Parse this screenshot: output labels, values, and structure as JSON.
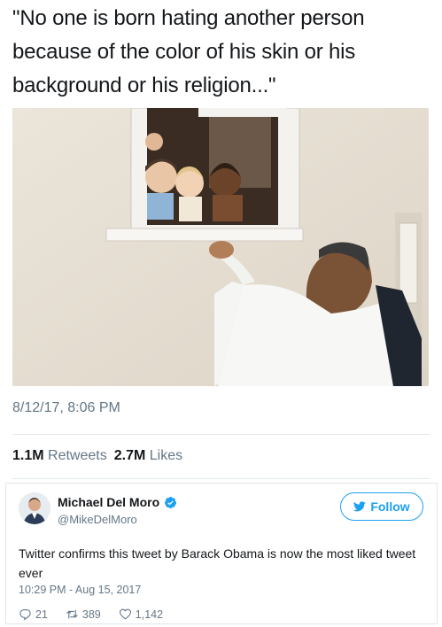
{
  "main_tweet": {
    "quote_lines": [
      "\"No one is born hating another person",
      "because of the color of his skin or his",
      "background or his religion...\""
    ],
    "timestamp": "8/12/17, 8:06 PM",
    "retweets_count": "1.1M",
    "retweets_label": "Retweets",
    "likes_count": "2.7M",
    "likes_label": "Likes"
  },
  "embedded_tweet": {
    "author_name": "Michael Del Moro",
    "author_handle": "@MikeDelMoro",
    "verified": true,
    "follow_label": "Follow",
    "text": "Twitter confirms this tweet by Barack Obama is now the most liked tweet ever",
    "time": "10:29 PM - Aug 15, 2017",
    "replies": "21",
    "retweets": "389",
    "likes": "1,142"
  },
  "colors": {
    "twitter_blue": "#1da1f2",
    "secondary_text": "#657786",
    "primary_text": "#14171a",
    "divider": "#e1e8ed"
  },
  "icons": {
    "verified": "verified-badge-icon",
    "follow": "twitter-bird-icon",
    "reply": "reply-icon",
    "retweet": "retweet-icon",
    "like": "heart-icon"
  }
}
